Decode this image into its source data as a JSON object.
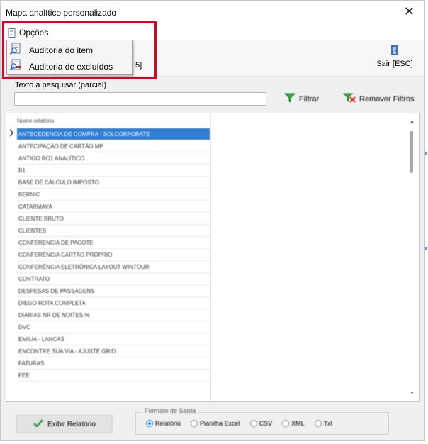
{
  "window": {
    "title": "Mapa analítico personalizado",
    "close_glyph": "✕"
  },
  "menu": {
    "opcoes_label": "Opções",
    "dropdown_items": [
      {
        "label": "Auditoria do item",
        "icon": "search-document-icon"
      },
      {
        "label": "Auditoria de excluídos",
        "icon": "deleted-audit-icon"
      }
    ]
  },
  "toolbar": {
    "partial_behind_menu": "5]",
    "sair_label": "Sair [ESC]",
    "sair_icon": "exit-door-icon"
  },
  "search": {
    "label": "Texto a pesquisar (parcial)",
    "value": "",
    "filtrar_label": "Filtrar",
    "remover_label": "Remover Filtros"
  },
  "list": {
    "header": "Nome relatório",
    "row_indicator": "❯",
    "rows": [
      "ANTECEDENCIA DE COMPRA - SOLCORPORATE",
      "ANTECIPAÇÃO DE CARTÃO MP",
      "ANTIGO RO1 ANALÍTICO",
      "B1",
      "BASE DE CÁLCULO IMPOSTO",
      "BERNIC",
      "CATARMAVÁ",
      "CLIENTE BRUTO",
      "CLIENTES",
      "CONFERENCIA DE PACOTE",
      "CONFERÊNCIA CARTÃO PRÓPRIO",
      "CONFERÊNCIA ELETRÔNICA LAYOUT WINTOUR",
      "CONTRATO",
      "DESPESAS DE PASSAGENS",
      "DIEGO ROTA COMPLETA",
      "DIÁRIAS NR DE NOITES %",
      "DVC",
      "EMILIA - LANCAS",
      "ENCONTRE SUA VIA - AJUSTE GRID",
      "FATURAS",
      "FEE"
    ]
  },
  "footer": {
    "exibir_label": "Exibir Relatório",
    "formato_legend": "Formato de Saída",
    "formats": [
      "Relatório",
      "Planilha Excel",
      "CSV",
      "XML",
      "Txt"
    ],
    "selected_format": "Relatório"
  },
  "colors": {
    "highlight_box": "#e0001b",
    "selection": "#2f7fd7",
    "radio_selected": "#1a73e8"
  }
}
